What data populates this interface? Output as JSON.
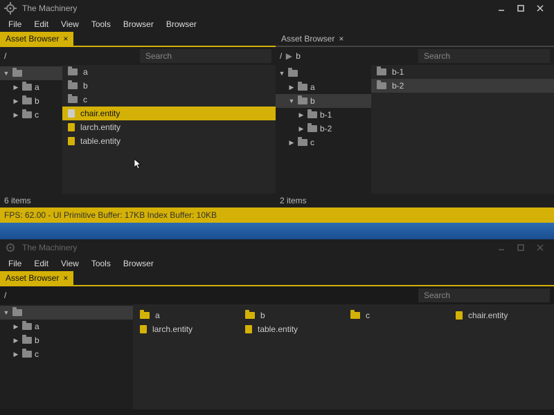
{
  "app_title": "The Machinery",
  "menus_top": [
    "File",
    "Edit",
    "View",
    "Tools",
    "Browser",
    "Browser"
  ],
  "menus_bottom": [
    "File",
    "Edit",
    "View",
    "Tools",
    "Browser"
  ],
  "tab_label": "Asset Browser",
  "search_placeholder": "Search",
  "panel_left": {
    "path": "/",
    "tree": [
      {
        "label": "",
        "depth": 0,
        "open": true,
        "sel": true
      },
      {
        "label": "a",
        "depth": 1,
        "open": false
      },
      {
        "label": "b",
        "depth": 1,
        "open": false
      },
      {
        "label": "c",
        "depth": 1,
        "open": false
      }
    ],
    "items": [
      {
        "kind": "folder",
        "label": "a"
      },
      {
        "kind": "folder",
        "label": "b"
      },
      {
        "kind": "folder",
        "label": "c"
      },
      {
        "kind": "file",
        "label": "chair.entity",
        "sel": true
      },
      {
        "kind": "file",
        "label": "larch.entity"
      },
      {
        "kind": "file",
        "label": "table.entity"
      }
    ],
    "footer": "6 items"
  },
  "panel_right": {
    "path_parts": [
      "/",
      "b"
    ],
    "tree": [
      {
        "label": "",
        "depth": 0,
        "open": true
      },
      {
        "label": "a",
        "depth": 1,
        "open": false
      },
      {
        "label": "b",
        "depth": 1,
        "open": true,
        "sel": true
      },
      {
        "label": "b-1",
        "depth": 2,
        "open": false
      },
      {
        "label": "b-2",
        "depth": 2,
        "open": false
      },
      {
        "label": "c",
        "depth": 1,
        "open": false
      }
    ],
    "items": [
      {
        "kind": "folder",
        "label": "b-1"
      },
      {
        "kind": "folder",
        "label": "b-2",
        "sel": true
      }
    ],
    "footer": "2 items"
  },
  "status": "FPS: 62.00 - UI Primitive Buffer: 17KB Index Buffer: 10KB",
  "bottom_window": {
    "path": "/",
    "tree": [
      {
        "label": "",
        "depth": 0,
        "open": true,
        "sel": true
      },
      {
        "label": "a",
        "depth": 1,
        "open": false
      },
      {
        "label": "b",
        "depth": 1,
        "open": false
      },
      {
        "label": "c",
        "depth": 1,
        "open": false
      }
    ],
    "grid": [
      [
        {
          "kind": "folder",
          "label": "a"
        },
        {
          "kind": "folder",
          "label": "b"
        },
        {
          "kind": "folder",
          "label": "c"
        },
        {
          "kind": "file",
          "label": "chair.entity"
        }
      ],
      [
        {
          "kind": "file",
          "label": "larch.entity"
        },
        {
          "kind": "file",
          "label": "table.entity"
        }
      ]
    ]
  }
}
